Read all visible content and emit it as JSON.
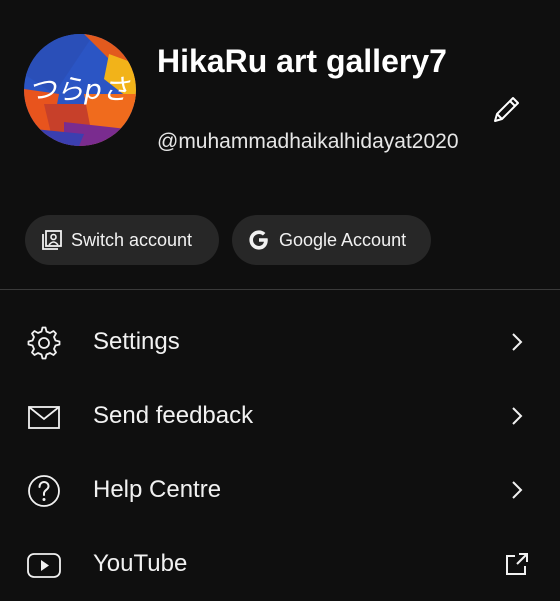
{
  "profile": {
    "name": "HikaRu art gallery7",
    "handle": "@muhammadhaikalhidayat2020",
    "avatar_text": "つらpさ"
  },
  "chips": {
    "switch_account": "Switch account",
    "google_account": "Google Account"
  },
  "menu": [
    {
      "label": "Settings",
      "icon": "gear-icon",
      "trailing": "chevron-right-icon"
    },
    {
      "label": "Send feedback",
      "icon": "mail-icon",
      "trailing": "chevron-right-icon"
    },
    {
      "label": "Help Centre",
      "icon": "help-circle-icon",
      "trailing": "chevron-right-icon"
    },
    {
      "label": "YouTube",
      "icon": "youtube-icon",
      "trailing": "external-link-icon"
    }
  ],
  "colors": {
    "background": "#0f0f0f",
    "chip_background": "#272727",
    "text": "#f1f1f1"
  }
}
